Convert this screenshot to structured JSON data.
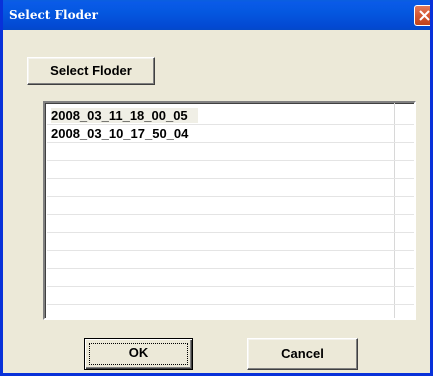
{
  "window": {
    "title": "Select Floder"
  },
  "dialog": {
    "select_folder_label": "Select Floder",
    "ok_label": "OK",
    "cancel_label": "Cancel"
  },
  "folder_list": {
    "items": [
      "2008_03_11_18_00_05",
      "2008_03_10_17_50_04",
      "",
      "",
      "",
      "",
      "",
      "",
      "",
      "",
      "",
      ""
    ],
    "selected_index": 0
  },
  "icons": {
    "close": "close-icon"
  },
  "colors": {
    "titlebar": "#0458e0",
    "close_button": "#d65a35",
    "dialog_face": "#ece9d8",
    "list_background": "#ffffff"
  }
}
